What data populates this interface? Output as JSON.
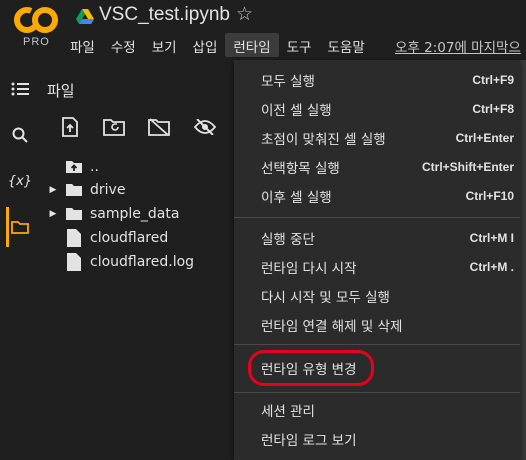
{
  "header": {
    "logo_text": "CO",
    "logo_badge": "PRO",
    "title": "VSC_test.ipynb",
    "last_edit": "오후 2:07에 마지막으",
    "menus": [
      "파일",
      "수정",
      "보기",
      "삽입",
      "런타임",
      "도구",
      "도움말"
    ],
    "active_menu": "런타임"
  },
  "panel": {
    "title": "파일",
    "tree": [
      {
        "label": "..",
        "type": "parent"
      },
      {
        "label": "drive",
        "type": "folder"
      },
      {
        "label": "sample_data",
        "type": "folder"
      },
      {
        "label": "cloudflared",
        "type": "file"
      },
      {
        "label": "cloudflared.log",
        "type": "file"
      }
    ]
  },
  "rail": {
    "icons": [
      "menu-icon",
      "search-icon",
      "variables-icon",
      "folder-icon"
    ],
    "variables_glyph": "{x}"
  },
  "runtime_menu": {
    "items": [
      {
        "label": "모두 실행",
        "shortcut": "Ctrl+F9"
      },
      {
        "label": "이전 셀 실행",
        "shortcut": "Ctrl+F8"
      },
      {
        "label": "초점이 맞춰진 셀 실행",
        "shortcut": "Ctrl+Enter"
      },
      {
        "label": "선택항목 실행",
        "shortcut": "Ctrl+Shift+Enter"
      },
      {
        "label": "이후 셀 실행",
        "shortcut": "Ctrl+F10"
      },
      {
        "label": "실행 중단",
        "shortcut": "Ctrl+M I"
      },
      {
        "label": "런타임 다시 시작",
        "shortcut": "Ctrl+M ."
      },
      {
        "label": "다시 시작 및 모두 실행",
        "shortcut": ""
      },
      {
        "label": "런타임 연결 해제 및 삭제",
        "shortcut": ""
      },
      {
        "label": "런타임 유형 변경",
        "shortcut": ""
      },
      {
        "label": "세션 관리",
        "shortcut": ""
      },
      {
        "label": "런타임 로그 보기",
        "shortcut": ""
      }
    ]
  },
  "colors": {
    "accent": "#f9ab00",
    "highlight": "#e8001c",
    "background": "#1f1f1f",
    "menu_bg": "#2b2b2b"
  }
}
